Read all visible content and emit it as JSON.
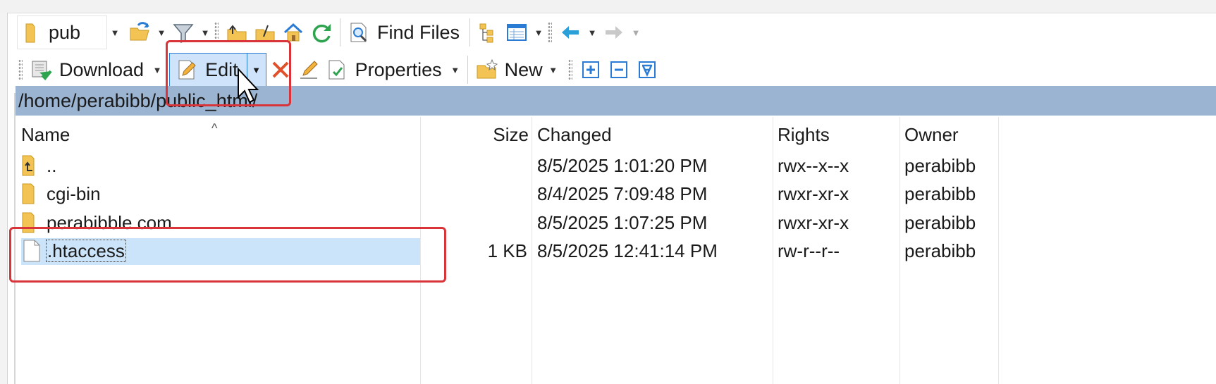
{
  "toolbar_top": {
    "drive_label": "pub",
    "find_files_label": "Find Files"
  },
  "toolbar_bottom": {
    "download_label": "Download",
    "edit_label": "Edit",
    "properties_label": "Properties",
    "new_label": "New"
  },
  "path": "/home/perabibb/public_html/",
  "columns": {
    "name": "Name",
    "size": "Size",
    "changed": "Changed",
    "rights": "Rights",
    "owner": "Owner"
  },
  "files": [
    {
      "name": "..",
      "size": "",
      "changed": "8/5/2025 1:01:20 PM",
      "rights": "rwx--x--x",
      "owner": "perabibb",
      "icon": "parent-folder-icon"
    },
    {
      "name": "cgi-bin",
      "size": "",
      "changed": "8/4/2025 7:09:48 PM",
      "rights": "rwxr-xr-x",
      "owner": "perabibb",
      "icon": "folder-icon"
    },
    {
      "name": "perabibble.com",
      "size": "",
      "changed": "8/5/2025 1:07:25 PM",
      "rights": "rwxr-xr-x",
      "owner": "perabibb",
      "icon": "folder-icon"
    },
    {
      "name": ".htaccess",
      "size": "1 KB",
      "changed": "8/5/2025 12:41:14 PM",
      "rights": "rw-r--r--",
      "owner": "perabibb",
      "icon": "file-icon",
      "selected": true
    }
  ],
  "colors": {
    "path_bar": "#9bb4d2",
    "selection": "#cce4f9",
    "highlight_box": "#d9343a",
    "accent_blue": "#2a7bd4"
  }
}
